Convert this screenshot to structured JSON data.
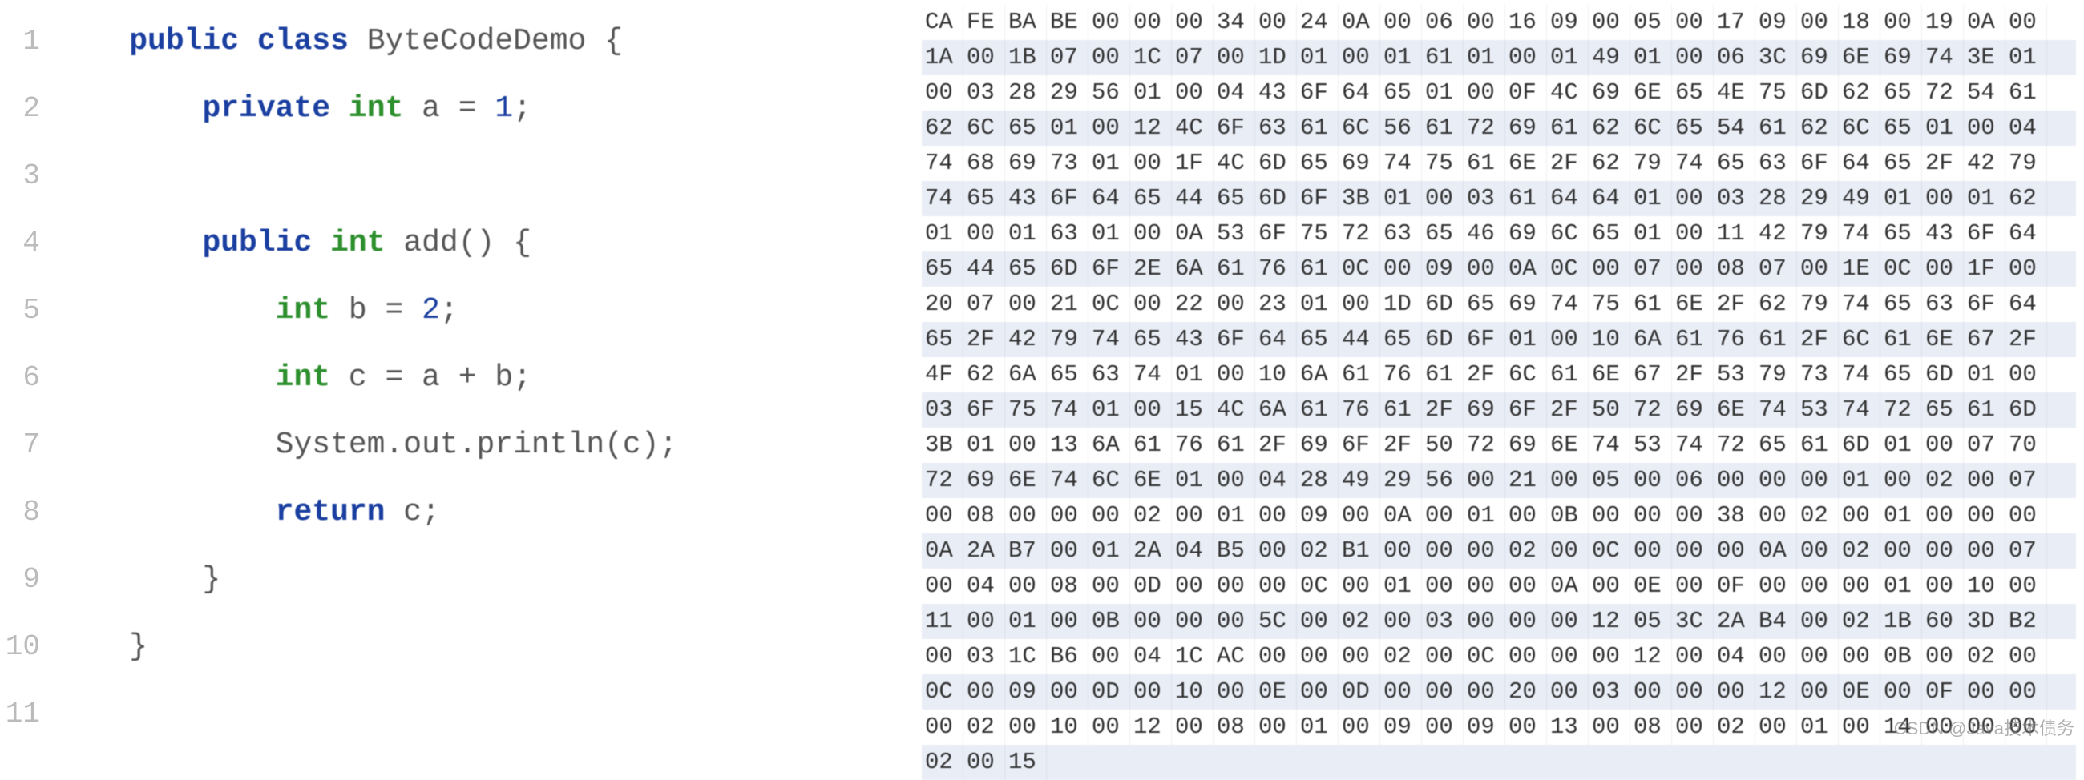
{
  "code": {
    "lines": [
      {
        "n": "1",
        "indent": "    ",
        "tokens": [
          [
            "kw",
            "public"
          ],
          [
            "sp",
            " "
          ],
          [
            "kw",
            "class"
          ],
          [
            "sp",
            " "
          ],
          [
            "id",
            "ByteCodeDemo"
          ],
          [
            "sp",
            " "
          ],
          [
            "punct",
            "{"
          ]
        ]
      },
      {
        "n": "2",
        "indent": "        ",
        "tokens": [
          [
            "kw",
            "private"
          ],
          [
            "sp",
            " "
          ],
          [
            "typ",
            "int"
          ],
          [
            "sp",
            " "
          ],
          [
            "id",
            "a"
          ],
          [
            "sp",
            " "
          ],
          [
            "punct",
            "="
          ],
          [
            "sp",
            " "
          ],
          [
            "num",
            "1"
          ],
          [
            "punct",
            ";"
          ]
        ]
      },
      {
        "n": "3",
        "indent": "",
        "tokens": []
      },
      {
        "n": "4",
        "indent": "        ",
        "tokens": [
          [
            "kw",
            "public"
          ],
          [
            "sp",
            " "
          ],
          [
            "typ",
            "int"
          ],
          [
            "sp",
            " "
          ],
          [
            "id",
            "add()"
          ],
          [
            "sp",
            " "
          ],
          [
            "punct",
            "{"
          ]
        ]
      },
      {
        "n": "5",
        "indent": "            ",
        "tokens": [
          [
            "typ",
            "int"
          ],
          [
            "sp",
            " "
          ],
          [
            "id",
            "b"
          ],
          [
            "sp",
            " "
          ],
          [
            "punct",
            "="
          ],
          [
            "sp",
            " "
          ],
          [
            "num",
            "2"
          ],
          [
            "punct",
            ";"
          ]
        ]
      },
      {
        "n": "6",
        "indent": "            ",
        "tokens": [
          [
            "typ",
            "int"
          ],
          [
            "sp",
            " "
          ],
          [
            "id",
            "c"
          ],
          [
            "sp",
            " "
          ],
          [
            "punct",
            "="
          ],
          [
            "sp",
            " "
          ],
          [
            "id",
            "a"
          ],
          [
            "sp",
            " "
          ],
          [
            "punct",
            "+"
          ],
          [
            "sp",
            " "
          ],
          [
            "id",
            "b"
          ],
          [
            "punct",
            ";"
          ]
        ]
      },
      {
        "n": "7",
        "indent": "            ",
        "tokens": [
          [
            "id",
            "System.out.println(c);"
          ]
        ]
      },
      {
        "n": "8",
        "indent": "            ",
        "tokens": [
          [
            "kw",
            "return"
          ],
          [
            "sp",
            " "
          ],
          [
            "id",
            "c"
          ],
          [
            "punct",
            ";"
          ]
        ]
      },
      {
        "n": "9",
        "indent": "        ",
        "tokens": [
          [
            "punct",
            "}"
          ]
        ]
      },
      {
        "n": "10",
        "indent": "    ",
        "tokens": [
          [
            "punct",
            "}"
          ]
        ]
      },
      {
        "n": "11",
        "indent": "",
        "tokens": []
      }
    ]
  },
  "hex": {
    "cols": 27,
    "rows": [
      "CA FE BA BE 00 00 00 34 00 24 0A 00 06 00 16 09 00 05 00 17 09 00 18 00 19 0A 00",
      "1A 00 1B 07 00 1C 07 00 1D 01 00 01 61 01 00 01 49 01 00 06 3C 69 6E 69 74 3E 01",
      "00 03 28 29 56 01 00 04 43 6F 64 65 01 00 0F 4C 69 6E 65 4E 75 6D 62 65 72 54 61",
      "62 6C 65 01 00 12 4C 6F 63 61 6C 56 61 72 69 61 62 6C 65 54 61 62 6C 65 01 00 04",
      "74 68 69 73 01 00 1F 4C 6D 65 69 74 75 61 6E 2F 62 79 74 65 63 6F 64 65 2F 42 79",
      "74 65 43 6F 64 65 44 65 6D 6F 3B 01 00 03 61 64 64 01 00 03 28 29 49 01 00 01 62",
      "01 00 01 63 01 00 0A 53 6F 75 72 63 65 46 69 6C 65 01 00 11 42 79 74 65 43 6F 64",
      "65 44 65 6D 6F 2E 6A 61 76 61 0C 00 09 00 0A 0C 00 07 00 08 07 00 1E 0C 00 1F 00",
      "20 07 00 21 0C 00 22 00 23 01 00 1D 6D 65 69 74 75 61 6E 2F 62 79 74 65 63 6F 64",
      "65 2F 42 79 74 65 43 6F 64 65 44 65 6D 6F 01 00 10 6A 61 76 61 2F 6C 61 6E 67 2F",
      "4F 62 6A 65 63 74 01 00 10 6A 61 76 61 2F 6C 61 6E 67 2F 53 79 73 74 65 6D 01 00",
      "03 6F 75 74 01 00 15 4C 6A 61 76 61 2F 69 6F 2F 50 72 69 6E 74 53 74 72 65 61 6D",
      "3B 01 00 13 6A 61 76 61 2F 69 6F 2F 50 72 69 6E 74 53 74 72 65 61 6D 01 00 07 70",
      "72 69 6E 74 6C 6E 01 00 04 28 49 29 56 00 21 00 05 00 06 00 00 00 01 00 02 00 07",
      "00 08 00 00 00 02 00 01 00 09 00 0A 00 01 00 0B 00 00 00 38 00 02 00 01 00 00 00",
      "0A 2A B7 00 01 2A 04 B5 00 02 B1 00 00 00 02 00 0C 00 00 00 0A 00 02 00 00 00 07",
      "00 04 00 08 00 0D 00 00 00 0C 00 01 00 00 00 0A 00 0E 00 0F 00 00 00 01 00 10 00",
      "11 00 01 00 0B 00 00 00 5C 00 02 00 03 00 00 00 12 05 3C 2A B4 00 02 1B 60 3D B2",
      "00 03 1C B6 00 04 1C AC 00 00 00 02 00 0C 00 00 00 12 00 04 00 00 00 0B 00 02 00",
      "0C 00 09 00 0D 00 10 00 0E 00 0D 00 00 00 20 00 03 00 00 00 12 00 0E 00 0F 00 00",
      "00 02 00 10 00 12 00 08 00 01 00 09 00 09 00 13 00 08 00 02 00 01 00 14 00 00 00",
      "02 00 15"
    ]
  },
  "watermark": "CSDN @Java技术债务"
}
